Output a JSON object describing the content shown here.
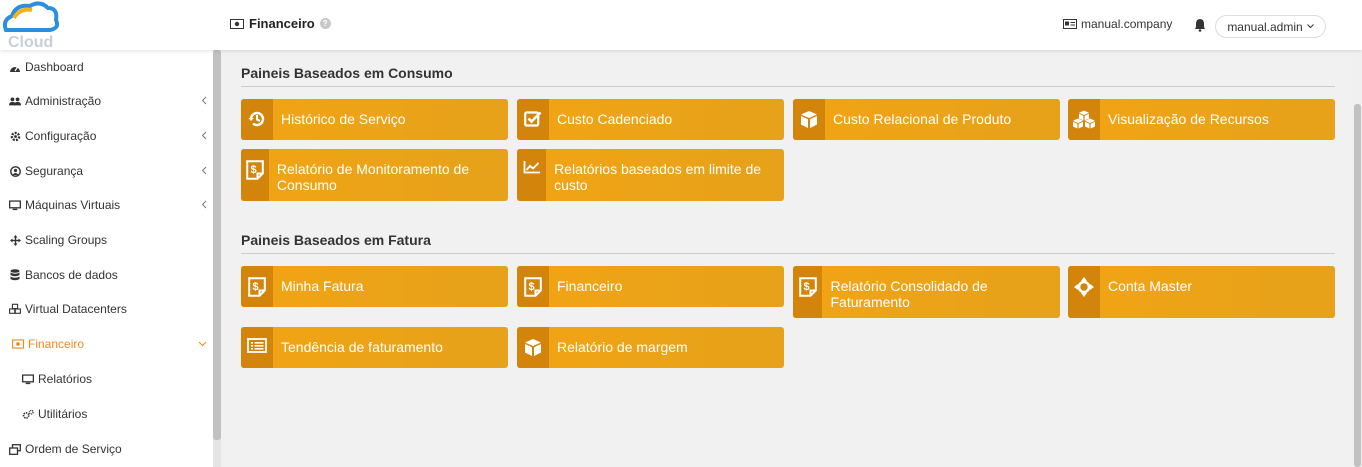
{
  "header": {
    "logo_text": "Cloud",
    "title": "Financeiro",
    "help": "?",
    "company": "manual.company",
    "user": "manual.admin"
  },
  "sidebar": {
    "items": [
      {
        "label": "Dashboard",
        "icon": "dashboard-icon"
      },
      {
        "label": "Administração",
        "icon": "users-icon"
      },
      {
        "label": "Configuração",
        "icon": "gear-icon"
      },
      {
        "label": "Segurança",
        "icon": "security-icon"
      },
      {
        "label": "Máquinas Virtuais",
        "icon": "monitor-icon"
      },
      {
        "label": "Scaling Groups",
        "icon": "arrows-icon"
      },
      {
        "label": "Bancos de dados",
        "icon": "database-icon"
      },
      {
        "label": "Virtual Datacenters",
        "icon": "cubes-icon"
      },
      {
        "label": "Financeiro",
        "icon": "money-icon"
      },
      {
        "label": "Relatórios",
        "icon": "monitor-icon"
      },
      {
        "label": "Utilitários",
        "icon": "cogs-icon"
      },
      {
        "label": "Ordem de Serviço",
        "icon": "windows-icon"
      }
    ]
  },
  "sections": [
    {
      "title": "Paineis Baseados em Consumo",
      "tiles": [
        {
          "label": "Histórico de Serviço",
          "icon": "history-icon"
        },
        {
          "label": "Custo Cadenciado",
          "icon": "checkbox-icon"
        },
        {
          "label": "Custo Relacional de Produto",
          "icon": "cube-icon"
        },
        {
          "label": "Visualização de Recursos",
          "icon": "cubes-icon"
        },
        {
          "label": "Relatório de Monitoramento de Consumo",
          "icon": "invoice-icon"
        },
        {
          "label": "Relatórios baseados em limite de custo",
          "icon": "line-chart-icon"
        }
      ]
    },
    {
      "title": "Paineis Baseados em Fatura",
      "tiles": [
        {
          "label": "Minha Fatura",
          "icon": "invoice-icon"
        },
        {
          "label": "Financeiro",
          "icon": "invoice-icon"
        },
        {
          "label": "Relatório Consolidado de Faturamento",
          "icon": "invoice-icon"
        },
        {
          "label": "Conta Master",
          "icon": "crosshair-icon"
        },
        {
          "label": "Tendência de faturamento",
          "icon": "list-icon"
        },
        {
          "label": "Relatório de margem",
          "icon": "cube-icon"
        }
      ]
    }
  ],
  "colors": {
    "tile": "#f2a414",
    "tile_icon_bg": "#d3850b",
    "active": "#f08a24"
  }
}
